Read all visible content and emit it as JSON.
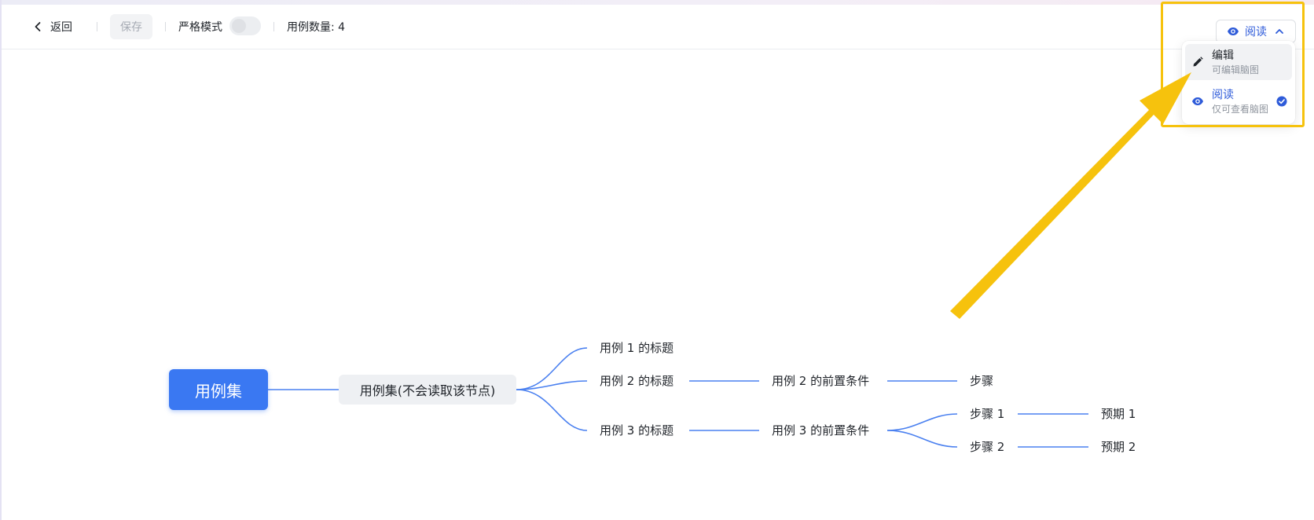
{
  "toolbar": {
    "back_label": "返回",
    "save_label": "保存",
    "strict_mode_label": "严格模式",
    "case_count_label": "用例数量: 4"
  },
  "mode_select": {
    "current": "阅读",
    "options": [
      {
        "title": "编辑",
        "desc": "可编辑脑图",
        "icon": "pencil-icon",
        "selected": false
      },
      {
        "title": "阅读",
        "desc": "仅可查看脑图",
        "icon": "eye-icon",
        "selected": true
      }
    ]
  },
  "mindmap": {
    "root": "用例集",
    "level1": "用例集(不会读取该节点)",
    "case1_title": "用例 1 的标题",
    "case2_title": "用例 2 的标题",
    "case2_precondition": "用例 2 的前置条件",
    "case2_step": "步骤",
    "case3_title": "用例 3 的标题",
    "case3_precondition": "用例 3 的前置条件",
    "case3_step1": "步骤 1",
    "case3_expect1": "预期 1",
    "case3_step2": "步骤 2",
    "case3_expect2": "预期 2"
  },
  "colors": {
    "accent": "#3a78f2",
    "link_blue": "#2e5bd9",
    "annotation_yellow": "#f6c20d"
  }
}
